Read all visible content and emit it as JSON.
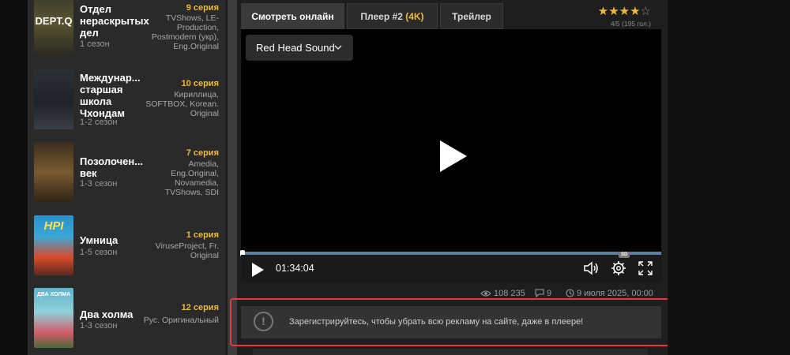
{
  "sidebar": {
    "shows": [
      {
        "title": "Отдел нераскрытых дел",
        "season": "1 сезон",
        "episode": "9 серия",
        "studios": "TVShows, LE-Production, Postmodern (укр), Eng.Original",
        "poster_text": "DEPT.Q"
      },
      {
        "title": "Междунар... старшая школа Чхондам",
        "season": "1-2 сезон",
        "episode": "10 серия",
        "studios": "Кириллица, SOFTBOX, Korean. Original",
        "poster_text": ""
      },
      {
        "title": "Позолочен... век",
        "season": "1-3 сезон",
        "episode": "7 серия",
        "studios": "Amedia, Eng.Original, Novamedia, TVShows, SDI",
        "poster_text": ""
      },
      {
        "title": "Умница",
        "season": "1-5 сезон",
        "episode": "1 серия",
        "studios": "ViruseProject, Fr. Original",
        "poster_text": "HPI"
      },
      {
        "title": "Два холма",
        "season": "1-3 сезон",
        "episode": "12 серия",
        "studios": "Рус. Оригинальный",
        "poster_text": "ДВА ХОЛМА"
      }
    ]
  },
  "tabs": [
    {
      "label": "Смотреть онлайн",
      "active": true
    },
    {
      "label": "Плеер #2",
      "highlight": "(4K)",
      "active": false
    },
    {
      "label": "Трейлер",
      "active": false
    }
  ],
  "rating": {
    "stars_filled": 4,
    "stars_total": 5,
    "text": "4/5 (195 гол.)"
  },
  "player": {
    "audio_track": "Red Head Sound",
    "time": "01:34:04",
    "quality_badge": "SD",
    "progress_fraction": 0.0
  },
  "meta": {
    "views": "108 235",
    "comments": "9",
    "date": "9 июля 2025, 00:00"
  },
  "notice": {
    "text": "Зарегистрируйтесь, чтобы убрать всю рекламу на сайте, даже в плеере!",
    "icon": "!"
  },
  "colors": {
    "accent": "#f0b93a",
    "highlight_frame": "#e23b3b",
    "progress": "#5c7fa3"
  }
}
